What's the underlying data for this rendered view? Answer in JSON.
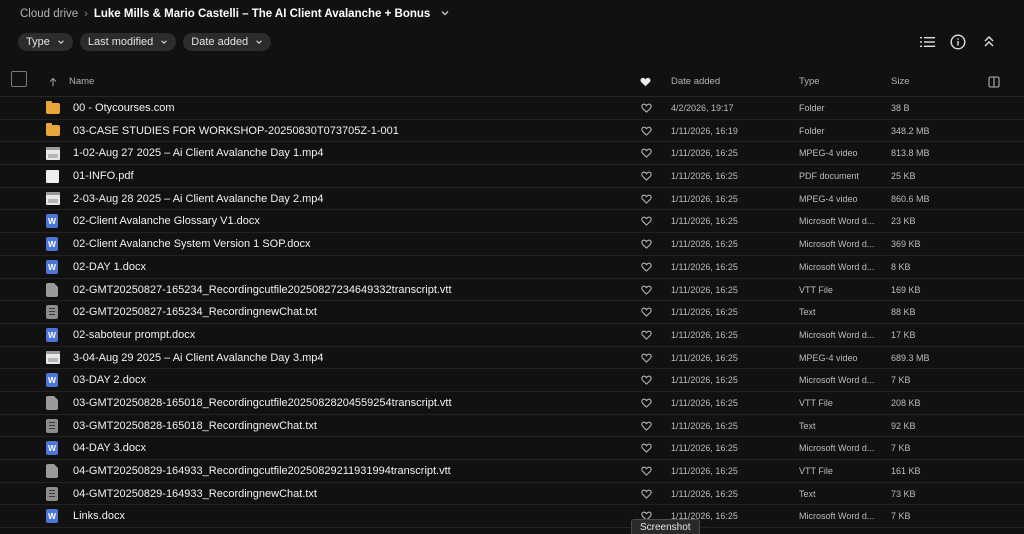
{
  "breadcrumb": {
    "root": "Cloud drive",
    "current": "Luke Mills & Mario Castelli – The AI Client Avalanche + Bonus"
  },
  "filters": [
    {
      "label": "Type"
    },
    {
      "label": "Last modified"
    },
    {
      "label": "Date added"
    }
  ],
  "columns": {
    "name": "Name",
    "date_added": "Date added",
    "type": "Type",
    "size": "Size"
  },
  "rows": [
    {
      "icon": "folder",
      "name": "00 - Otycourses.com",
      "date": "4/2/2026, 19:17",
      "type": "Folder",
      "size": "38 B"
    },
    {
      "icon": "folder",
      "name": "03-CASE STUDIES FOR WORKSHOP-20250830T073705Z-1-001",
      "date": "1/11/2026, 16:19",
      "type": "Folder",
      "size": "348.2 MB"
    },
    {
      "icon": "video",
      "name": "1-02-Aug 27 2025 – Ai Client Avalanche Day 1.mp4",
      "date": "1/11/2026, 16:25",
      "type": "MPEG-4 video",
      "size": "813.8 MB"
    },
    {
      "icon": "pdf",
      "name": "01-INFO.pdf",
      "date": "1/11/2026, 16:25",
      "type": "PDF document",
      "size": "25 KB"
    },
    {
      "icon": "video",
      "name": "2-03-Aug 28 2025 – Ai Client Avalanche Day 2.mp4",
      "date": "1/11/2026, 16:25",
      "type": "MPEG-4 video",
      "size": "860.6 MB"
    },
    {
      "icon": "word",
      "name": "02-Client Avalanche Glossary V1.docx",
      "date": "1/11/2026, 16:25",
      "type": "Microsoft Word d...",
      "size": "23 KB"
    },
    {
      "icon": "word",
      "name": "02-Client Avalanche System Version 1 SOP.docx",
      "date": "1/11/2026, 16:25",
      "type": "Microsoft Word d...",
      "size": "369 KB"
    },
    {
      "icon": "word",
      "name": "02-DAY 1.docx",
      "date": "1/11/2026, 16:25",
      "type": "Microsoft Word d...",
      "size": "8 KB"
    },
    {
      "icon": "doc",
      "name": "02-GMT20250827-165234_Recordingcutfile20250827234649332transcript.vtt",
      "date": "1/11/2026, 16:25",
      "type": "VTT File",
      "size": "169 KB"
    },
    {
      "icon": "text",
      "name": "02-GMT20250827-165234_RecordingnewChat.txt",
      "date": "1/11/2026, 16:25",
      "type": "Text",
      "size": "88 KB"
    },
    {
      "icon": "word",
      "name": "02-saboteur prompt.docx",
      "date": "1/11/2026, 16:25",
      "type": "Microsoft Word d...",
      "size": "17 KB"
    },
    {
      "icon": "video",
      "name": "3-04-Aug 29 2025 – Ai Client Avalanche Day 3.mp4",
      "date": "1/11/2026, 16:25",
      "type": "MPEG-4 video",
      "size": "689.3 MB"
    },
    {
      "icon": "word",
      "name": "03-DAY 2.docx",
      "date": "1/11/2026, 16:25",
      "type": "Microsoft Word d...",
      "size": "7 KB"
    },
    {
      "icon": "doc",
      "name": "03-GMT20250828-165018_Recordingcutfile20250828204559254transcript.vtt",
      "date": "1/11/2026, 16:25",
      "type": "VTT File",
      "size": "208 KB"
    },
    {
      "icon": "text",
      "name": "03-GMT20250828-165018_RecordingnewChat.txt",
      "date": "1/11/2026, 16:25",
      "type": "Text",
      "size": "92 KB"
    },
    {
      "icon": "word",
      "name": "04-DAY 3.docx",
      "date": "1/11/2026, 16:25",
      "type": "Microsoft Word d...",
      "size": "7 KB"
    },
    {
      "icon": "doc",
      "name": "04-GMT20250829-164933_Recordingcutfile20250829211931994transcript.vtt",
      "date": "1/11/2026, 16:25",
      "type": "VTT File",
      "size": "161 KB"
    },
    {
      "icon": "text",
      "name": "04-GMT20250829-164933_RecordingnewChat.txt",
      "date": "1/11/2026, 16:25",
      "type": "Text",
      "size": "73 KB"
    },
    {
      "icon": "word",
      "name": "Links.docx",
      "date": "1/11/2026, 16:25",
      "type": "Microsoft Word d...",
      "size": "7 KB"
    }
  ],
  "tooltip": "Screenshot",
  "colors": {
    "background": "#111111",
    "folder": "#e8a53a",
    "word": "#4d76d8"
  }
}
